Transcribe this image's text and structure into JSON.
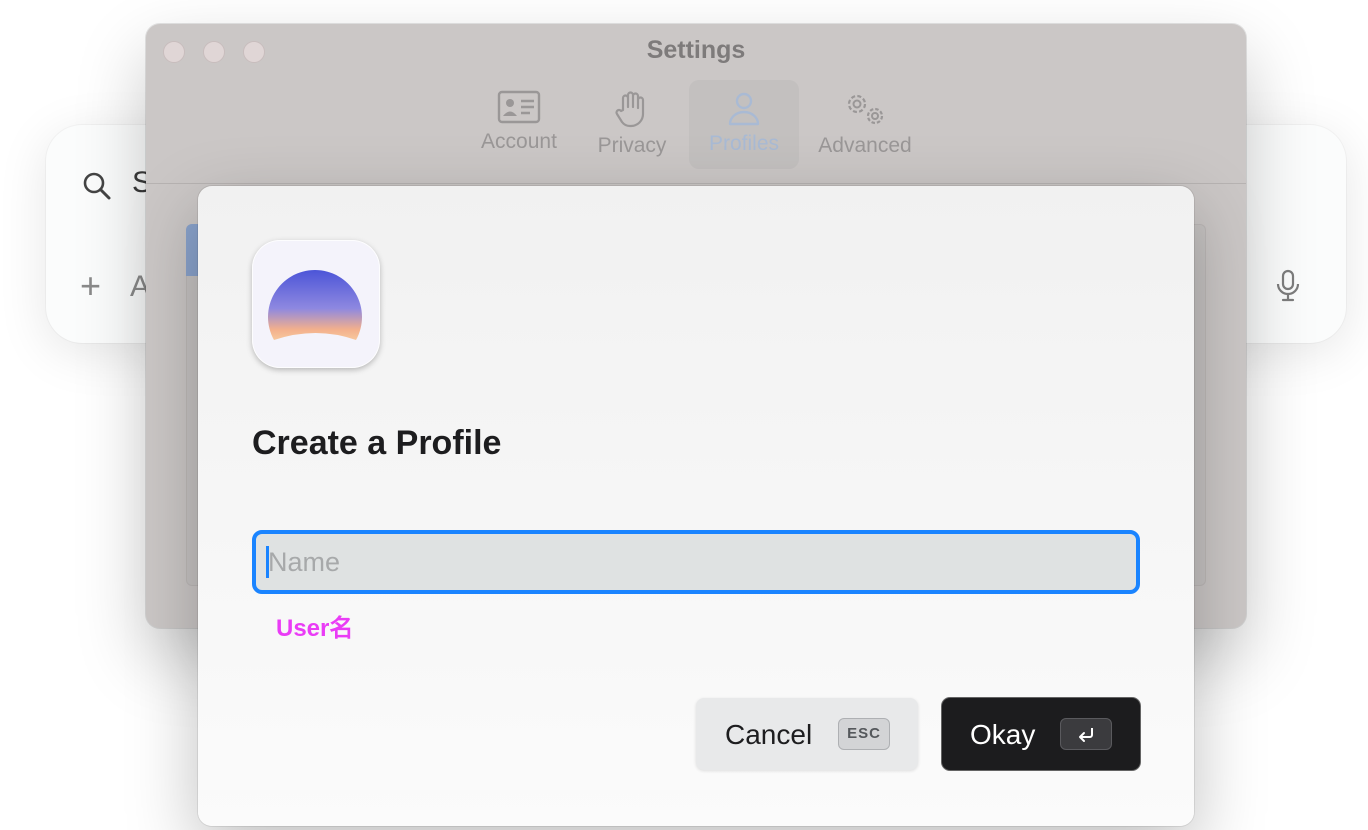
{
  "background_app": {
    "search_text": "S",
    "add_text": "A",
    "search_icon": "search-icon",
    "plus_icon": "plus-icon",
    "mic_icon": "microphone-icon"
  },
  "settings_window": {
    "title": "Settings",
    "tabs": [
      {
        "label": "Account",
        "icon": "contact-card-icon",
        "active": false
      },
      {
        "label": "Privacy",
        "icon": "hand-icon",
        "active": false
      },
      {
        "label": "Profiles",
        "icon": "person-icon",
        "active": true
      },
      {
        "label": "Advanced",
        "icon": "gears-icon",
        "active": false
      }
    ]
  },
  "dialog": {
    "app_icon": "app-logo-icon",
    "title": "Create a Profile",
    "name_input": {
      "placeholder": "Name",
      "value": ""
    },
    "annotation": "User名",
    "cancel_button": {
      "label": "Cancel",
      "shortcut": "ESC"
    },
    "okay_button": {
      "label": "Okay",
      "shortcut_icon": "return-key-icon"
    }
  },
  "colors": {
    "accent": "#1a84ff",
    "annotation": "#ea3cf6",
    "primary_button": "#1c1c1e"
  }
}
